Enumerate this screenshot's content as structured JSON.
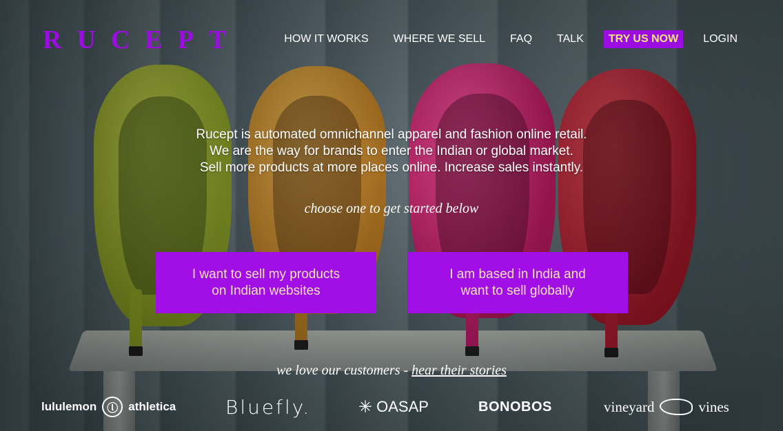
{
  "brand": {
    "logo_text": "RUCEPT",
    "accent_color": "#a20ee6",
    "cta_text_color": "#f5e67a"
  },
  "nav": {
    "items": [
      {
        "label": "HOW IT WORKS"
      },
      {
        "label": "WHERE WE SELL"
      },
      {
        "label": "FAQ"
      },
      {
        "label": "TALK"
      },
      {
        "label": "TRY US NOW",
        "highlight": true
      },
      {
        "label": "LOGIN"
      }
    ]
  },
  "hero": {
    "line1": "Rucept is automated omnichannel apparel and fashion online retail.",
    "line2": "We are the way for brands to enter the Indian or global market.",
    "line3": "Sell more products at more places online. Increase sales instantly.",
    "choose_prompt": "choose one to get started below"
  },
  "actions": {
    "sell_india": {
      "line1": "I want to sell my products",
      "line2": "on Indian websites"
    },
    "sell_global": {
      "line1": "I am based in India and",
      "line2": "want to sell globally"
    }
  },
  "stories": {
    "prefix": "we love our customers - ",
    "link": "hear their stories"
  },
  "customers": {
    "lululemon": {
      "left": "lululemon",
      "mark": "ⓛ",
      "right": "athletica"
    },
    "bluefly": "Bluefly.",
    "oasap": {
      "mark": "✳",
      "text": "OASAP"
    },
    "bonobos": "BONOBOS",
    "vineyard_vines": {
      "left": "vineyard",
      "right": "vines"
    }
  },
  "background": {
    "icons": [
      "yellow-green-heel",
      "orange-heel",
      "magenta-heel",
      "red-heel",
      "wooden-stool"
    ]
  }
}
